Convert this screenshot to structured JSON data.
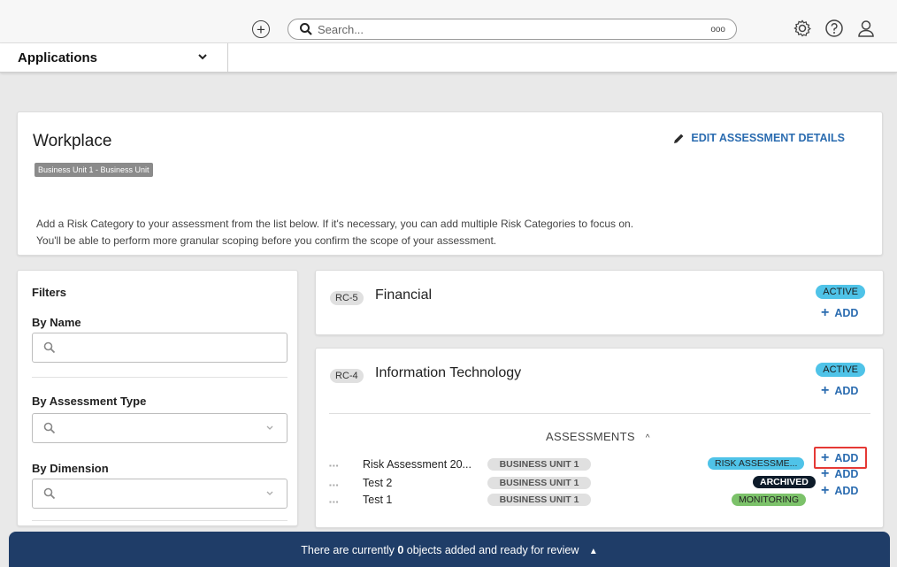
{
  "header": {
    "search_placeholder": "Search...",
    "search_more": "ooo",
    "icons": [
      "add-icon",
      "search-icon",
      "gear-icon",
      "help-icon",
      "user-icon"
    ]
  },
  "app_bar": {
    "app_label": "Applications"
  },
  "assessment": {
    "title": "Workplace",
    "edit_label": "EDIT ASSESSMENT DETAILS",
    "business_unit_badge": "Business Unit 1 - Business Unit",
    "description_line1": "Add a Risk Category to your assessment from the list below. If it's necessary, you can add multiple Risk Categories to focus on.",
    "description_line2": "You'll be able to perform more granular scoping before you confirm the scope of your assessment."
  },
  "filters": {
    "title": "Filters",
    "by_name": "By Name",
    "by_assessment_type": "By Assessment Type",
    "by_dimension": "By Dimension"
  },
  "risk_categories": [
    {
      "code": "RC-5",
      "name": "Financial",
      "status": "ACTIVE",
      "add_label": "ADD"
    },
    {
      "code": "RC-4",
      "name": "Information Technology",
      "status": "ACTIVE",
      "add_label": "ADD"
    }
  ],
  "assessments_section": {
    "header": "ASSESSMENTS",
    "rows": [
      {
        "name": "Risk Assessment 20...",
        "business_unit": "BUSINESS UNIT 1",
        "status": "RISK ASSESSME...",
        "add_label": "ADD"
      },
      {
        "name": "Test 2",
        "business_unit": "BUSINESS UNIT 1",
        "status": "ARCHIVED",
        "add_label": "ADD"
      },
      {
        "name": "Test 1",
        "business_unit": "BUSINESS UNIT 1",
        "status": "MONITORING",
        "add_label": "ADD"
      }
    ]
  },
  "review_bar": {
    "prefix": "There are currently",
    "count": "0",
    "suffix": "objects added and ready for review"
  },
  "colors": {
    "accent": "#2b6cb0",
    "active": "#4fc3e8",
    "archived": "#0d1b2a",
    "monitoring": "#7cc26a",
    "risk_assessment": "#4fc3e8",
    "review_bar": "#1f3d68",
    "highlight": "#e53935"
  }
}
